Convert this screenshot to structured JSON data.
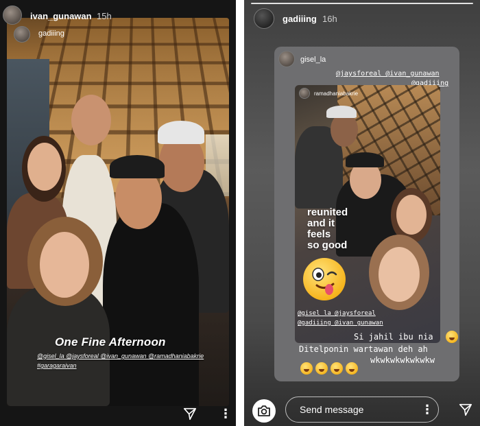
{
  "left_story": {
    "username": "ivan_gunawan",
    "time_ago": "15h",
    "mention_sticker": "gadiiing",
    "caption_title": "One Fine Afternoon",
    "caption_mentions": "@gisel_la @jaysforeal @ivan_gunawan @ramadhaniabakrie",
    "caption_hashtag": "#garagaraivan",
    "icons": [
      "send-icon",
      "more-vertical-icon"
    ]
  },
  "right_story": {
    "username": "gadiiing",
    "time_ago": "16h",
    "shared_from": "gisel_la",
    "top_mentions_line1": "@jaysforeal @ivan_gunawan",
    "top_mentions_line2": "@gadiiing",
    "inner_story": {
      "username": "ramadhaniabakrie",
      "sticker_text": [
        "reunited",
        "and it",
        "feels",
        "so good"
      ],
      "mentions_line1": "@gisel_la @jaysforeal",
      "mentions_line2": "@gadiiing @ivan_gunawan"
    },
    "reply_line1": "Si jahil ibu nia",
    "reply_line2": "Ditelponin wartawan deh ah",
    "reply_line3": "wkwkwkwkwkwkw",
    "emoji_count": 4,
    "message_placeholder": "Send message",
    "icons": [
      "camera-icon",
      "more-vertical-icon",
      "send-icon"
    ]
  },
  "colors": {
    "story_bg_dark": "#151515",
    "card_gray": "#6e6e70",
    "text": "#ffffff"
  }
}
